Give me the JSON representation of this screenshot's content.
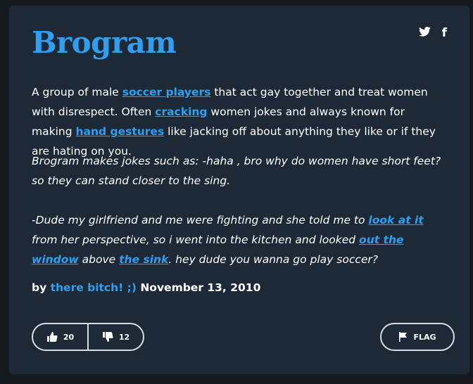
{
  "definition": {
    "word": "Brogram",
    "social": {
      "twitter": "twitter-icon",
      "facebook": "f"
    },
    "meaning": {
      "t1": "A group of male ",
      "l1": "soccer players",
      "t2": " that act gay together and treat women with disrespect. Often ",
      "l2": "cracking",
      "t3": " women jokes and always known for making ",
      "l3": "hand gestures",
      "t4": " like jacking off about anything they like or if they are hating on you."
    },
    "example": {
      "p1": "Brogram makes jokes such as: -haha , bro why do women have short feet? so they can stand closer to the sing.",
      "t1": "-Dude my girlfriend and me were fighting and she told me to ",
      "l1": "look at it",
      "t2": " from her perspective, so i went into the kitchen and looked ",
      "l2": "out the window",
      "t3": " above ",
      "l3": "the sink",
      "t4": ". hey dude you wanna go play soccer?"
    },
    "contributor": {
      "by": "by",
      "author": "there bitch! ;)",
      "date": "November 13, 2010"
    },
    "votes": {
      "up": "20",
      "down": "12"
    },
    "flag_label": "FLAG"
  }
}
